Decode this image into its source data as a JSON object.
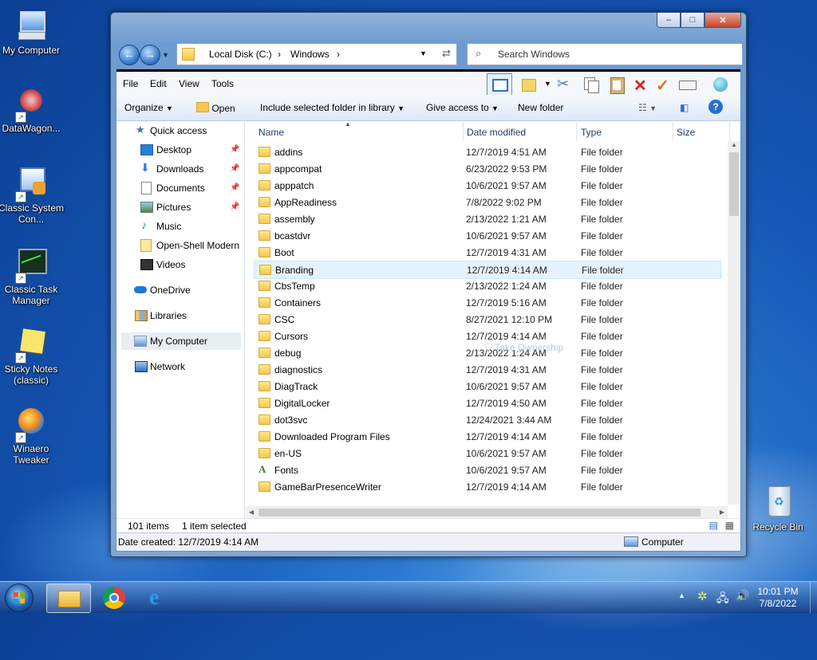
{
  "desktop": {
    "icons": [
      {
        "label": "My Computer",
        "icon": "computer-icon"
      },
      {
        "label": "DataWagon...",
        "icon": "datawagon-icon"
      },
      {
        "label": "Classic System Con...",
        "icon": "control-panel-icon"
      },
      {
        "label": "Classic Task Manager",
        "icon": "task-manager-icon"
      },
      {
        "label": "Sticky Notes (classic)",
        "icon": "sticky-notes-icon"
      },
      {
        "label": "Winaero Tweaker",
        "icon": "winaero-icon"
      },
      {
        "label": "Recycle Bin",
        "icon": "recycle-bin-icon"
      }
    ]
  },
  "window": {
    "caption_buttons": {
      "minimize": "–",
      "maximize": "□",
      "close": "✕"
    },
    "address": {
      "segments": [
        "Local Disk (C:)",
        "Windows"
      ],
      "sep": "›"
    },
    "search_placeholder": "Search Windows",
    "menu": [
      "File",
      "Edit",
      "View",
      "Tools"
    ],
    "commands": {
      "organize": "Organize",
      "open": "Open",
      "include": "Include selected folder in library",
      "share": "Give access to",
      "new_folder": "New folder"
    },
    "nav": {
      "quick_access": "Quick access",
      "pinned": [
        {
          "label": "Desktop",
          "pinned": true
        },
        {
          "label": "Downloads",
          "pinned": true
        },
        {
          "label": "Documents",
          "pinned": true
        },
        {
          "label": "Pictures",
          "pinned": true
        },
        {
          "label": "Music",
          "pinned": false
        },
        {
          "label": "Open-Shell Modern",
          "pinned": false
        },
        {
          "label": "Videos",
          "pinned": false
        }
      ],
      "onedrive": "OneDrive",
      "libraries": "Libraries",
      "my_computer": "My Computer",
      "network": "Network"
    },
    "columns": [
      "Name",
      "Date modified",
      "Type",
      "Size"
    ],
    "rows": [
      {
        "name": "addins",
        "date": "12/7/2019 4:51 AM",
        "type": "File folder"
      },
      {
        "name": "appcompat",
        "date": "6/23/2022 9:53 PM",
        "type": "File folder"
      },
      {
        "name": "apppatch",
        "date": "10/6/2021 9:57 AM",
        "type": "File folder"
      },
      {
        "name": "AppReadiness",
        "date": "7/8/2022 9:02 PM",
        "type": "File folder"
      },
      {
        "name": "assembly",
        "date": "2/13/2022 1:21 AM",
        "type": "File folder"
      },
      {
        "name": "bcastdvr",
        "date": "10/6/2021 9:57 AM",
        "type": "File folder"
      },
      {
        "name": "Boot",
        "date": "12/7/2019 4:31 AM",
        "type": "File folder"
      },
      {
        "name": "Branding",
        "date": "12/7/2019 4:14 AM",
        "type": "File folder",
        "selected": true
      },
      {
        "name": "CbsTemp",
        "date": "2/13/2022 1:24 AM",
        "type": "File folder"
      },
      {
        "name": "Containers",
        "date": "12/7/2019 5:16 AM",
        "type": "File folder"
      },
      {
        "name": "CSC",
        "date": "8/27/2021 12:10 PM",
        "type": "File folder"
      },
      {
        "name": "Cursors",
        "date": "12/7/2019 4:14 AM",
        "type": "File folder"
      },
      {
        "name": "debug",
        "date": "2/13/2022 1:24 AM",
        "type": "File folder"
      },
      {
        "name": "diagnostics",
        "date": "12/7/2019 4:31 AM",
        "type": "File folder"
      },
      {
        "name": "DiagTrack",
        "date": "10/6/2021 9:57 AM",
        "type": "File folder"
      },
      {
        "name": "DigitalLocker",
        "date": "12/7/2019 4:50 AM",
        "type": "File folder"
      },
      {
        "name": "dot3svc",
        "date": "12/24/2021 3:44 AM",
        "type": "File folder"
      },
      {
        "name": "Downloaded Program Files",
        "date": "12/7/2019 4:14 AM",
        "type": "File folder"
      },
      {
        "name": "en-US",
        "date": "10/6/2021 9:57 AM",
        "type": "File folder"
      },
      {
        "name": "Fonts",
        "date": "10/6/2021 9:57 AM",
        "type": "File folder",
        "font": true
      },
      {
        "name": "GameBarPresenceWriter",
        "date": "12/7/2019 4:14 AM",
        "type": "File folder"
      }
    ],
    "watermark": "Take Ownership",
    "status": {
      "count": "101 items",
      "selected": "1 item selected"
    },
    "details": {
      "created": "Date created: 12/7/2019 4:14 AM",
      "location": "Computer"
    }
  },
  "taskbar": {
    "time": "10:01 PM",
    "date": "7/8/2022",
    "pinned": [
      "start-orb-icon",
      "file-explorer-icon",
      "chrome-icon",
      "internet-explorer-icon"
    ]
  },
  "colors": {
    "folder": "#f3c74d",
    "selection": "#e5f3ff",
    "taskbar": "#1d4f9a"
  }
}
